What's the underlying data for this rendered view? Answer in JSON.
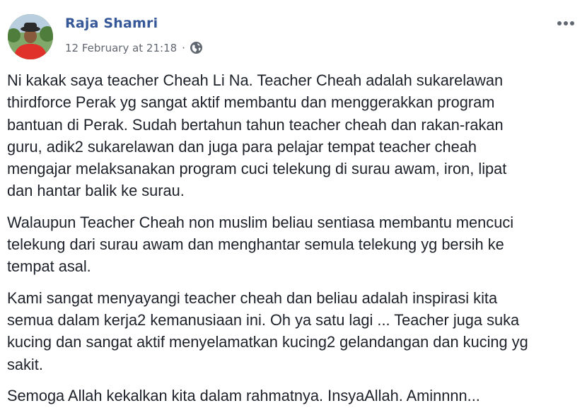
{
  "post": {
    "author": "Raja Shamri",
    "date": "12 February at 21:18",
    "separator": "·",
    "privacy_icon": "globe-icon",
    "more_icon": "more-options-icon",
    "paragraphs": [
      [
        "Ni kakak saya teacher Cheah Li Na. Teacher Cheah adalah sukarelawan",
        "thirdforce Perak yg sangat aktif membantu dan menggerakkan program",
        "bantuan di Perak. Sudah bertahun tahun teacher cheah dan rakan-rakan",
        "guru, adik2 sukarelawan dan juga para pelajar tempat teacher cheah",
        "mengajar melaksanakan program cuci telekung di surau awam, iron, lipat",
        "dan hantar balik ke surau."
      ],
      [
        "Walaupun Teacher Cheah non muslim beliau sentiasa membantu mencuci",
        "telekung dari surau awam dan menghantar semula telekung yg bersih ke",
        "tempat asal."
      ],
      [
        "Kami sangat menyayangi teacher cheah dan beliau adalah inspirasi kita",
        "semua dalam kerja2 kemanusiaan ini. Oh ya satu lagi ... Teacher juga suka",
        "kucing dan sangat aktif menyelamatkan kucing2 gelandangan dan kucing yg",
        "sakit."
      ],
      [
        "Semoga Allah kekalkan kita dalam rahmatnya. InsyaAllah. Aminnnn..."
      ]
    ]
  }
}
